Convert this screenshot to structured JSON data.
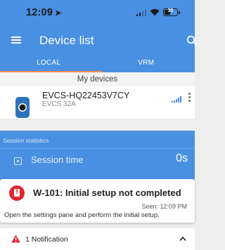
{
  "status_bar": {
    "time": "12:09",
    "battery": "30"
  },
  "header": {
    "title": "Device list",
    "tabs": [
      "LOCAL",
      "VRM"
    ],
    "active_tab": "LOCAL"
  },
  "devices": {
    "section_title": "My devices",
    "items": [
      {
        "name": "EVCS-HQ22453V7CY",
        "model": "EVCS 32A"
      }
    ]
  },
  "session_statistics": {
    "label": "Session statistics",
    "session_time_label": "Session time",
    "session_time_value": "0s"
  },
  "notification": {
    "title": "W-101: Initial setup not completed",
    "seen": "Seen: 12:09 PM",
    "message": "Open the settings pane and perform the initial setup."
  },
  "notification_footer": {
    "count_text": "1 Notification"
  },
  "colors": {
    "primary": "#4990e2",
    "accent": "#f08a4b",
    "error": "#e3262e"
  }
}
